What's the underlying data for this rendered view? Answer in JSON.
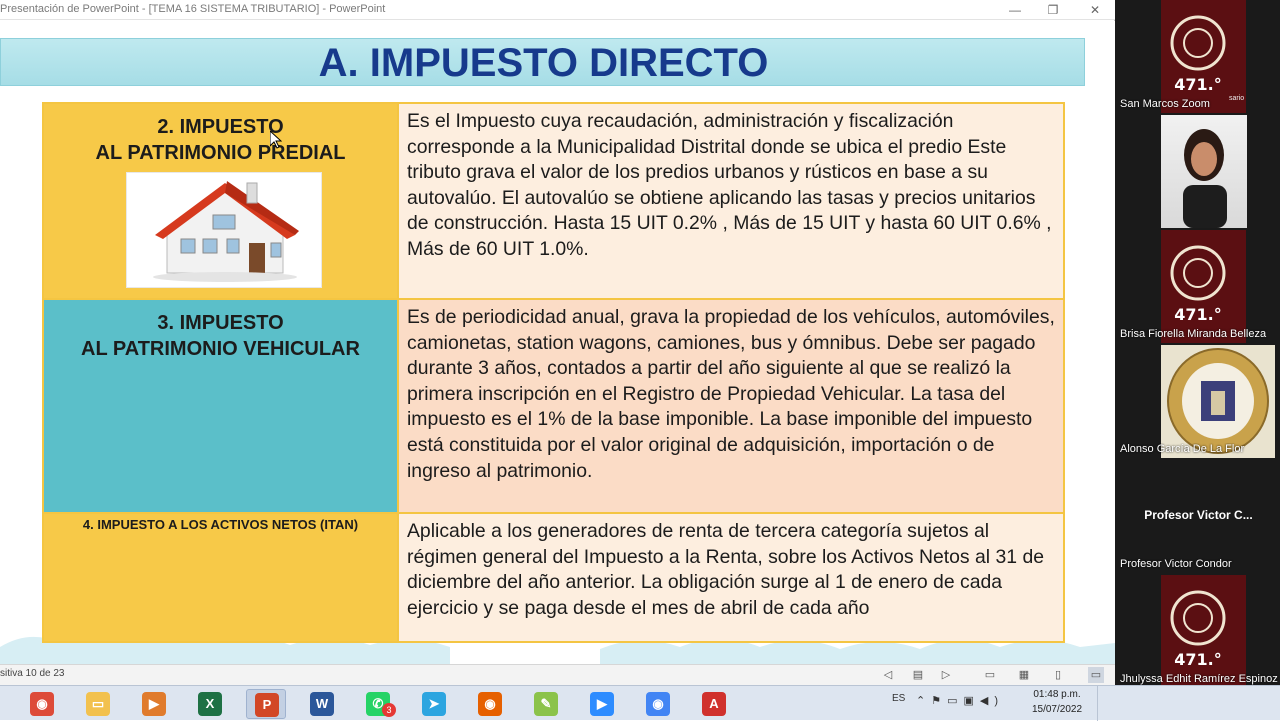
{
  "window": {
    "title": "Presentación de PowerPoint - [TEMA 16 SISTEMA TRIBUTARIO] - PowerPoint",
    "minimize": "—",
    "restore": "❐",
    "close": "✕"
  },
  "slide": {
    "title": "A. IMPUESTO DIRECTO",
    "rows": [
      {
        "heading_line1": "2. IMPUESTO",
        "heading_line2": "AL PATRIMONIO PREDIAL",
        "description": "Es el Impuesto cuya recaudación, administración y fiscalización corresponde a la Municipalidad Distrital donde se ubica el predio Este tributo grava el valor de los predios urbanos y rústicos en base a su autovalúo. El autovalúo se obtiene aplicando las tasas y precios unitarios de construcción. Hasta 15 UIT 0.2% , Más de 15 UIT y hasta 60 UIT 0.6% , Más de 60 UIT 1.0%.",
        "left_color": "#f7c948",
        "right_color": "#fdeedf"
      },
      {
        "heading_line1": "3. IMPUESTO",
        "heading_line2": "AL PATRIMONIO VEHICULAR",
        "description": "Es de periodicidad anual, grava la propiedad de los vehículos, automóviles, camionetas, station wagons, camiones, bus y ómnibus. Debe ser pagado durante 3 años, contados a partir del año siguiente al que se realizó la primera inscripción en el Registro de Propiedad Vehicular. La tasa del impuesto es el 1% de la base imponible. La base imponible del impuesto está constituida por el valor original de adquisición, importación o de ingreso al patrimonio.",
        "left_color": "#5bbfc9",
        "right_color": "#fbdcc6"
      },
      {
        "heading_line1": "4. IMPUESTO A LOS ACTIVOS NETOS (ITAN)",
        "description": "Aplicable a los generadores de renta de tercera categoría sujetos al régimen general del Impuesto a la Renta, sobre los Activos Netos al 31 de diciembre del año anterior. La obligación surge al 1 de enero de cada ejercicio y se paga desde el mes de abril de cada año",
        "left_color": "#f7c948",
        "right_color": "#fdeedf"
      }
    ]
  },
  "statusbar": {
    "slide_count": "sitiva 10 de 23"
  },
  "zoom": {
    "participants": [
      {
        "name": "San Marcos Zoom",
        "logo_text": "471.°",
        "logo_sub": "sario"
      },
      {
        "name": ""
      },
      {
        "name": "Brisa Fiorella Miranda Belleza",
        "logo_text": "471.°"
      },
      {
        "name": "Alonso García De La Flor"
      },
      {
        "name": "Profesor Victor Condor",
        "center_label": "Profesor Victor C..."
      },
      {
        "name": "Jhulyssa Edhit Ramírez Espinoz",
        "logo_text": "471.°"
      }
    ]
  },
  "taskbar": {
    "apps": [
      {
        "icon": "chrome-icon",
        "color": "#dd4b39",
        "glyph": "◉"
      },
      {
        "icon": "file-explorer-icon",
        "color": "#f2c14e",
        "glyph": "▭"
      },
      {
        "icon": "media-player-icon",
        "color": "#e07b2c",
        "glyph": "▶"
      },
      {
        "icon": "excel-icon",
        "color": "#1e7145",
        "glyph": "X"
      },
      {
        "icon": "powerpoint-icon",
        "color": "#d24726",
        "glyph": "P"
      },
      {
        "icon": "word-icon",
        "color": "#2b579a",
        "glyph": "W"
      },
      {
        "icon": "whatsapp-icon",
        "color": "#25d366",
        "glyph": "✆",
        "badge": "3"
      },
      {
        "icon": "telegram-icon",
        "color": "#2ca5e0",
        "glyph": "➤"
      },
      {
        "icon": "firefox-icon",
        "color": "#e66000",
        "glyph": "◉"
      },
      {
        "icon": "paint-icon",
        "color": "#8bc34a",
        "glyph": "✎"
      },
      {
        "icon": "zoom-icon",
        "color": "#2d8cff",
        "glyph": "▶"
      },
      {
        "icon": "chrome-alt-icon",
        "color": "#4285f4",
        "glyph": "◉"
      },
      {
        "icon": "acrobat-icon",
        "color": "#d0312d",
        "glyph": "A"
      }
    ],
    "language": "ES",
    "time": "01:48 p.m.",
    "date": "15/07/2022"
  }
}
